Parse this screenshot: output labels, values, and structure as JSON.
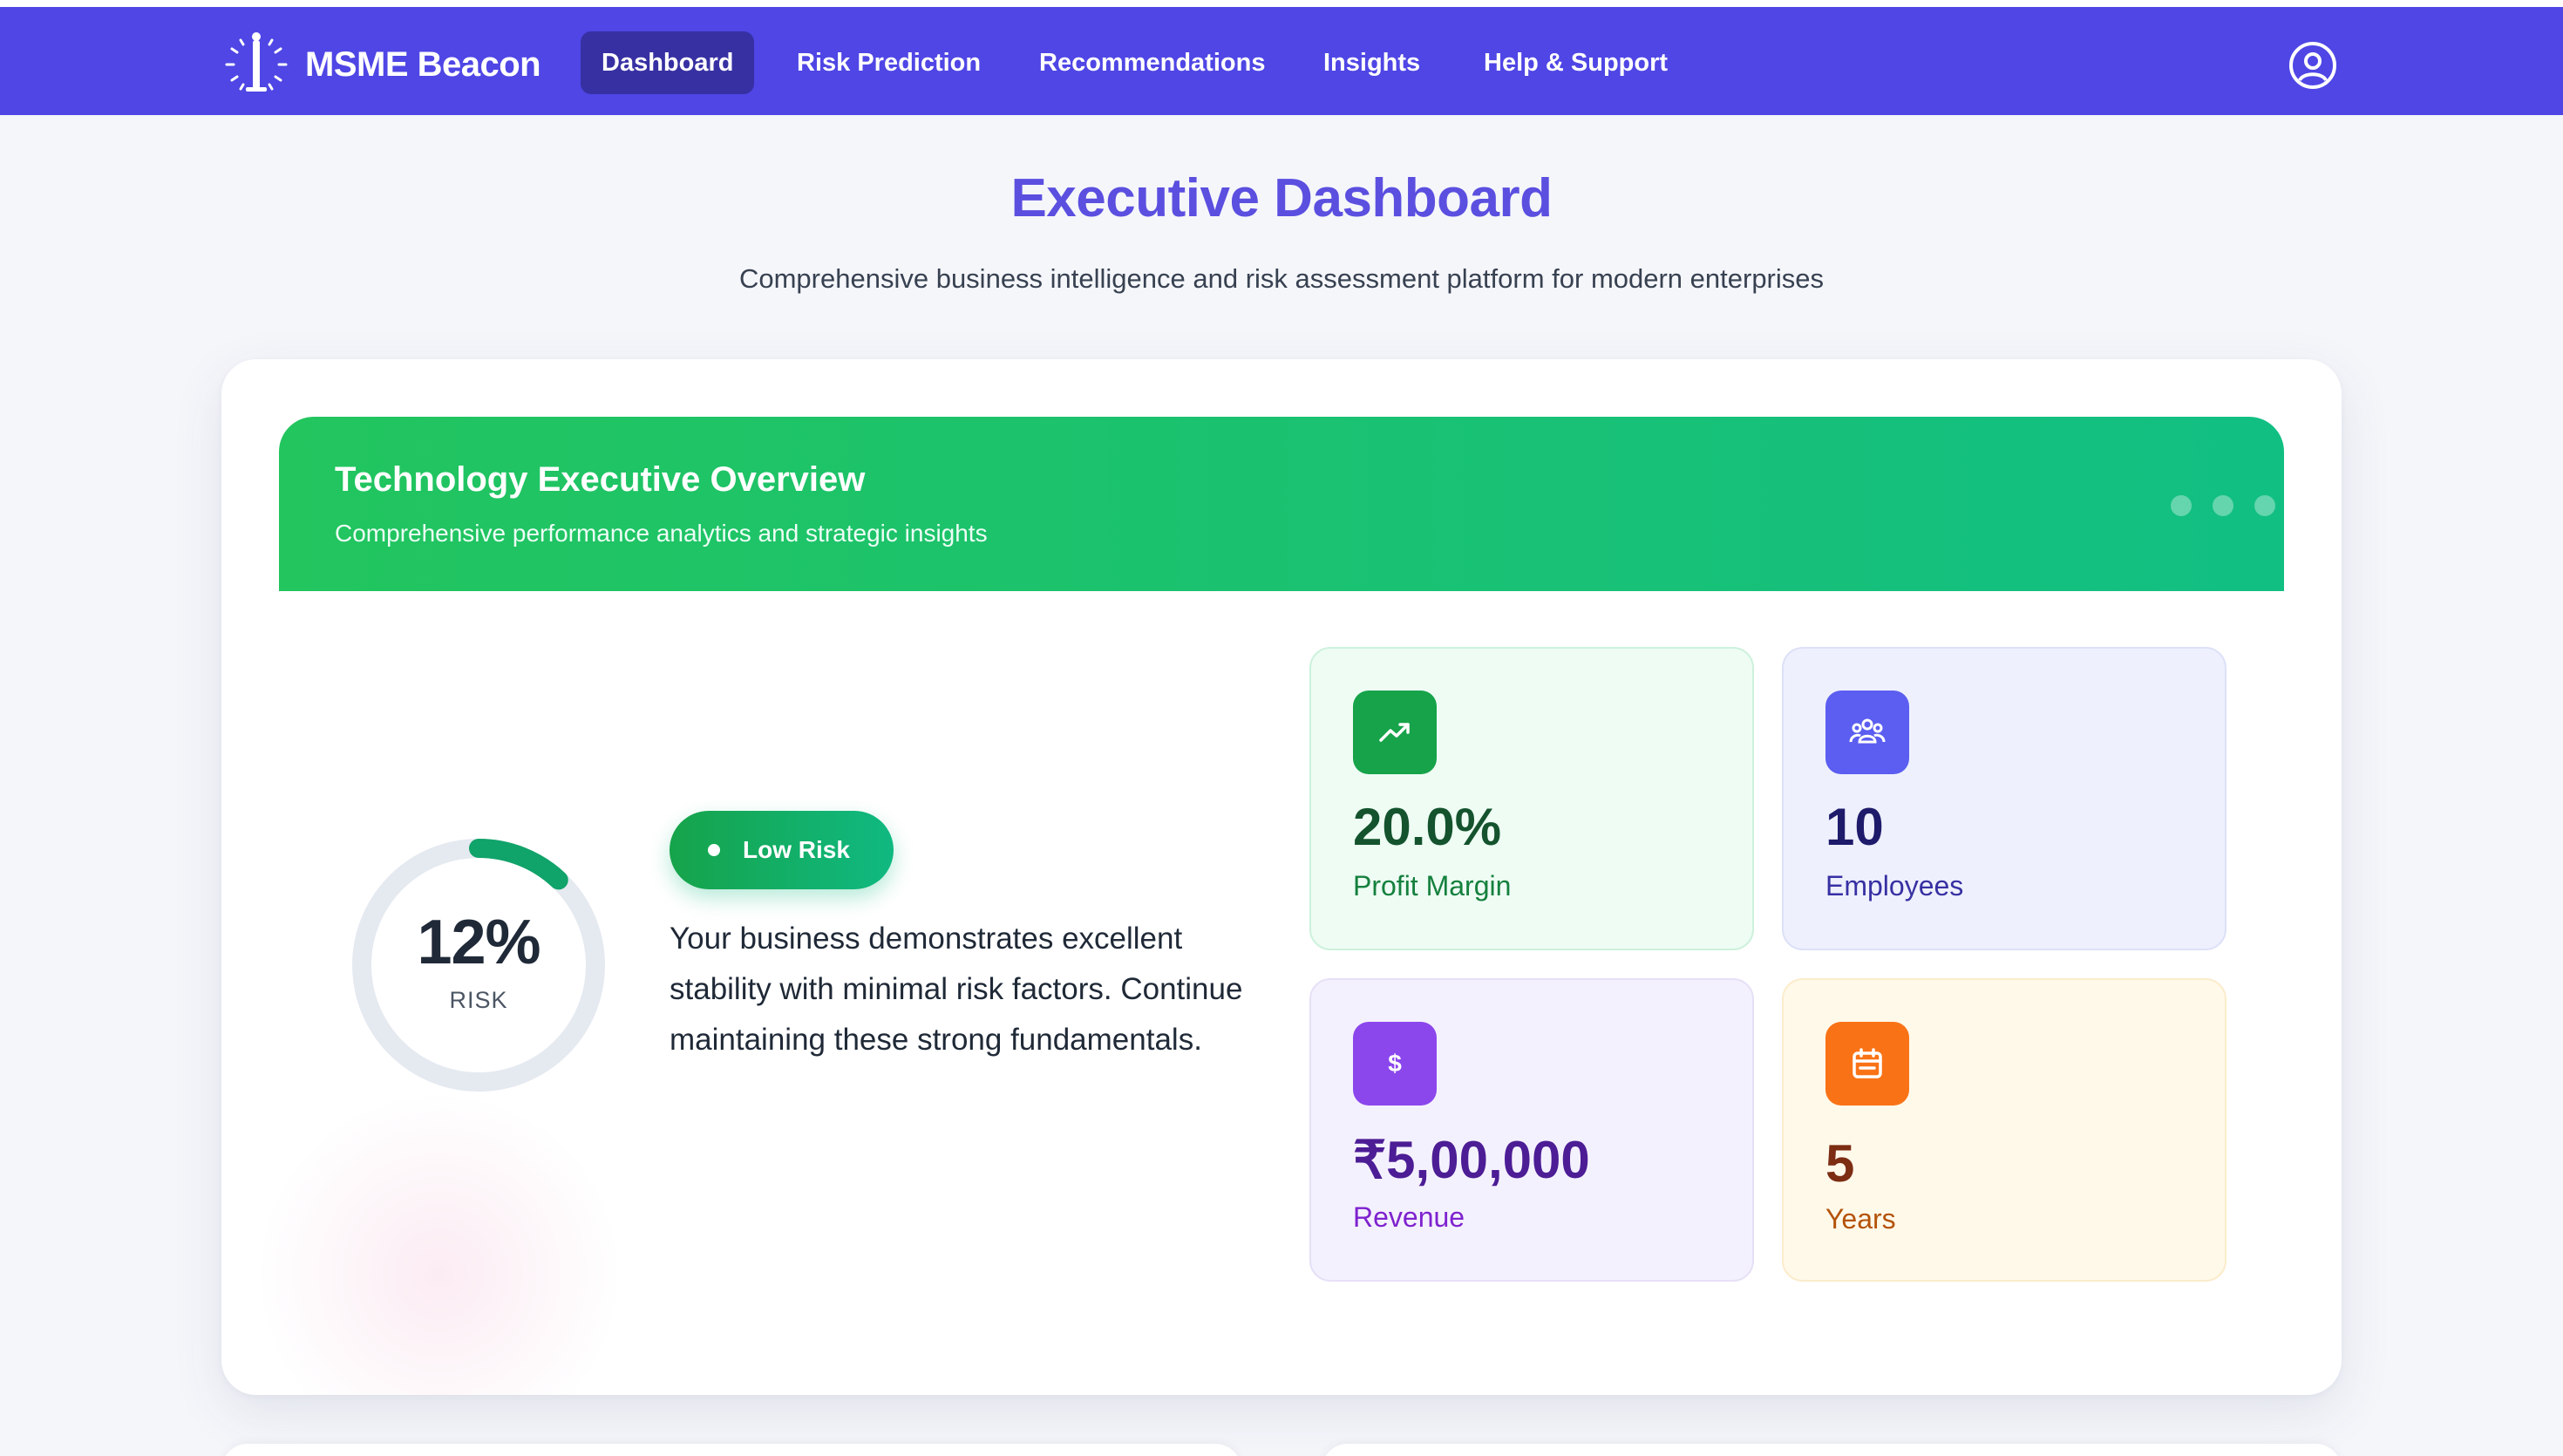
{
  "nav": {
    "brand": "MSME Beacon",
    "items": [
      {
        "label": "Dashboard",
        "active": true
      },
      {
        "label": "Risk Prediction"
      },
      {
        "label": "Recommendations"
      },
      {
        "label": "Insights"
      },
      {
        "label": "Help & Support"
      }
    ],
    "user_icon": "user-circle-icon"
  },
  "header": {
    "title": "Executive Dashboard",
    "subtitle": "Comprehensive business intelligence and risk assessment platform for modern enterprises"
  },
  "overview": {
    "title": "Technology Executive Overview",
    "subtitle": "Comprehensive performance analytics and strategic insights",
    "risk": {
      "percent": 12,
      "value": "12%",
      "label": "RISK",
      "badge": "Low Risk",
      "description": "Your business demonstrates excellent stability with minimal risk factors. Continue maintaining these strong fundamentals."
    },
    "metrics": [
      {
        "value": "20.0%",
        "label": "Profit Margin",
        "icon": "trending-up-icon"
      },
      {
        "value": "10",
        "label": "Employees",
        "icon": "users-icon"
      },
      {
        "value": "₹5,00,000",
        "label": "Revenue",
        "icon": "dollar-icon",
        "icon_text": "$"
      },
      {
        "value": "5",
        "label": "Years",
        "icon": "calendar-icon"
      }
    ]
  },
  "colors": {
    "nav_bg": "#4f46e5",
    "title": "#5b4fe0",
    "banner_start": "#22c55e",
    "banner_end": "#12bf83",
    "gauge_progress": "#10a36a",
    "gauge_track": "#e5e9f0"
  }
}
